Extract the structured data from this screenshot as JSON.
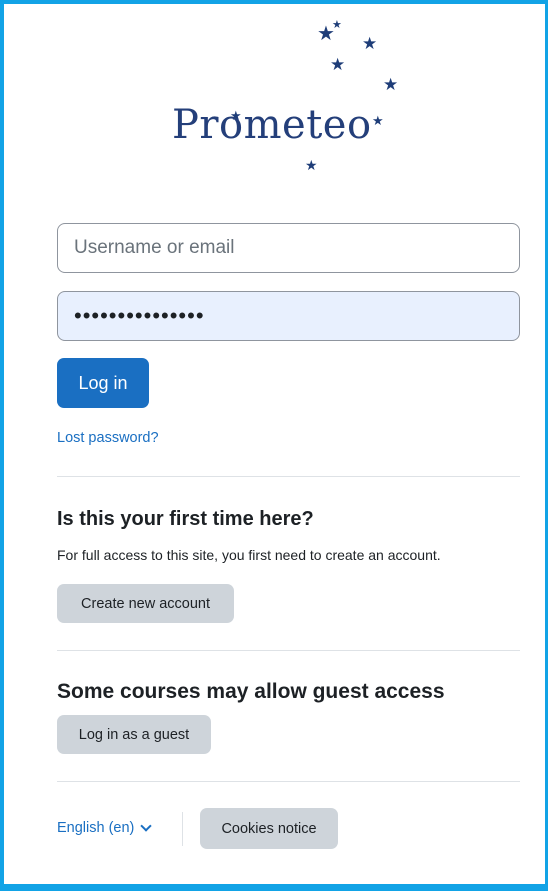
{
  "logo": {
    "wordmark": "Prometeo"
  },
  "login": {
    "username_placeholder": "Username or email",
    "password_value": "•••••••••••••••",
    "login_button": "Log in",
    "lost_password": "Lost password?"
  },
  "signup": {
    "heading": "Is this your first time here?",
    "text": "For full access to this site, you first need to create an account.",
    "button": "Create new account"
  },
  "guest": {
    "heading": "Some courses may allow guest access",
    "button": "Log in as a guest"
  },
  "footer": {
    "language": "English (en)",
    "cookies_button": "Cookies notice"
  },
  "colors": {
    "frame": "#12a3e6",
    "primary": "#1a6fc2",
    "secondary_button": "#ced4da",
    "logo": "#243f7a"
  }
}
